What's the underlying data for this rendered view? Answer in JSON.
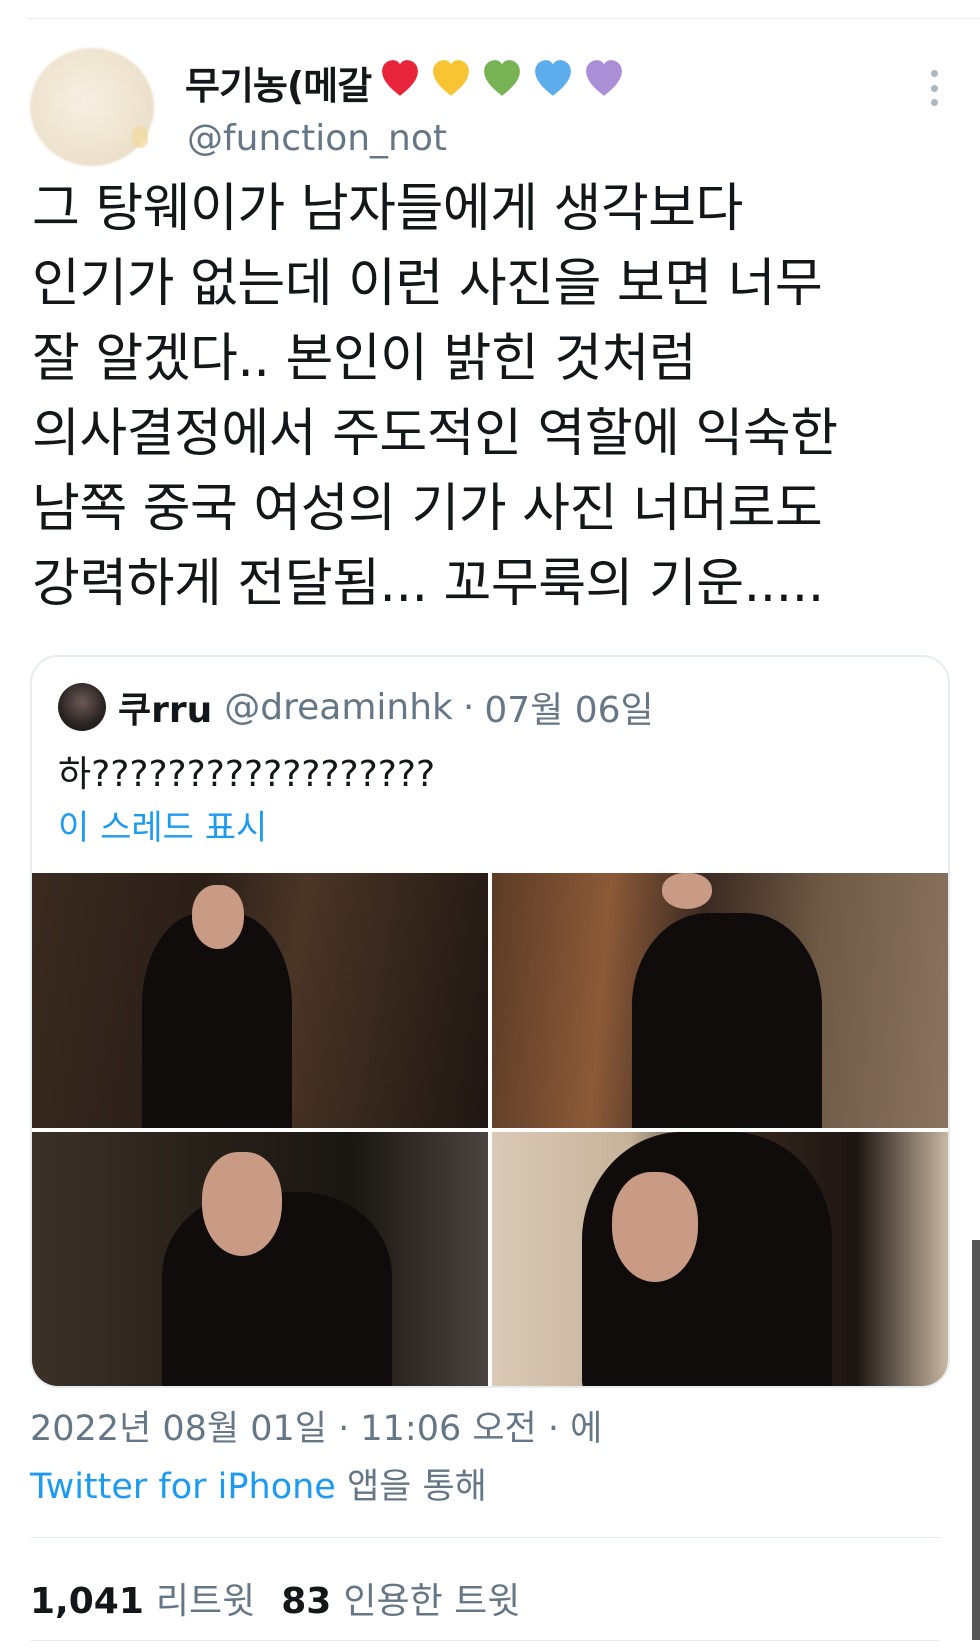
{
  "author": {
    "display_name": "무기농(메갈",
    "handle": "@function_not",
    "hearts": [
      {
        "name": "red-heart-icon",
        "color": "#e8253b"
      },
      {
        "name": "yellow-heart-icon",
        "color": "#f7c433"
      },
      {
        "name": "green-heart-icon",
        "color": "#77b255"
      },
      {
        "name": "blue-heart-icon",
        "color": "#5dadec"
      },
      {
        "name": "purple-heart-icon",
        "color": "#aa8ed6"
      }
    ]
  },
  "tweet": {
    "lines": [
      "그 탕웨이가 남자들에게 생각보다",
      "인기가 없는데 이런 사진을 보면 너무",
      "잘 알겠다.. 본인이 밝힌 것처럼",
      "의사결정에서 주도적인 역할에 익숙한",
      "남쪽 중국 여성의 기가 사진 너머로도",
      "강력하게 전달됨... 꼬무룩의 기운....."
    ]
  },
  "quote": {
    "name": "쿠rru",
    "handle": "@dreaminhk",
    "separator": "·",
    "date": "07월 06일",
    "text": "하??????????????????",
    "show_thread": "이 스레드 표시"
  },
  "meta": {
    "timestamp": "2022년 08월 01일 · 11:06 오전 · 에",
    "source": "Twitter for iPhone",
    "source_suffix": " 앱을 통해"
  },
  "stats": {
    "retweets_count": "1,041",
    "retweets_label": "리트윗",
    "quotes_count": "83",
    "quotes_label": "인용한 트윗"
  }
}
